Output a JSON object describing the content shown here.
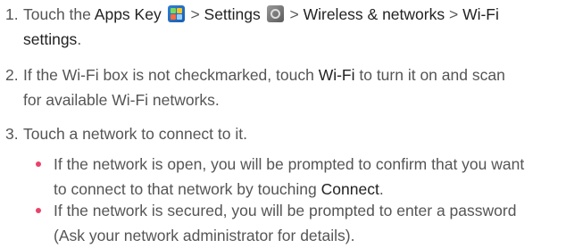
{
  "steps": [
    {
      "number": "1.",
      "text_a": "Touch the ",
      "apps_key": "Apps Key",
      "text_b": " > ",
      "settings": "Settings",
      "text_c": " > ",
      "wireless": "Wireless & networks",
      "text_d": " > ",
      "wifi_settings_1": "Wi-Fi",
      "wifi_settings_2": "settings",
      "text_e": "."
    },
    {
      "number": "2.",
      "text_a": "If the Wi-Fi box is not checkmarked, touch ",
      "wifi": "Wi-Fi",
      "text_b": " to turn it on and scan",
      "line2": "for available Wi-Fi networks."
    },
    {
      "number": "3.",
      "text": "Touch a network to connect to it."
    }
  ],
  "bullets": [
    {
      "line1": "If the network is open, you will be prompted to confirm that you want",
      "line2_a": "to connect to that network by touching ",
      "connect": "Connect",
      "line2_b": "."
    },
    {
      "line1": "If the network is secured, you will be prompted to enter a password",
      "line2": "(Ask your network administrator for details)."
    }
  ],
  "icons": {
    "apps": "apps-key-icon",
    "settings": "settings-icon"
  },
  "colors": {
    "text": "#555555",
    "emphasis": "#222222",
    "bullet": "#e8436a",
    "apps_icon": "#2e7fd3"
  }
}
